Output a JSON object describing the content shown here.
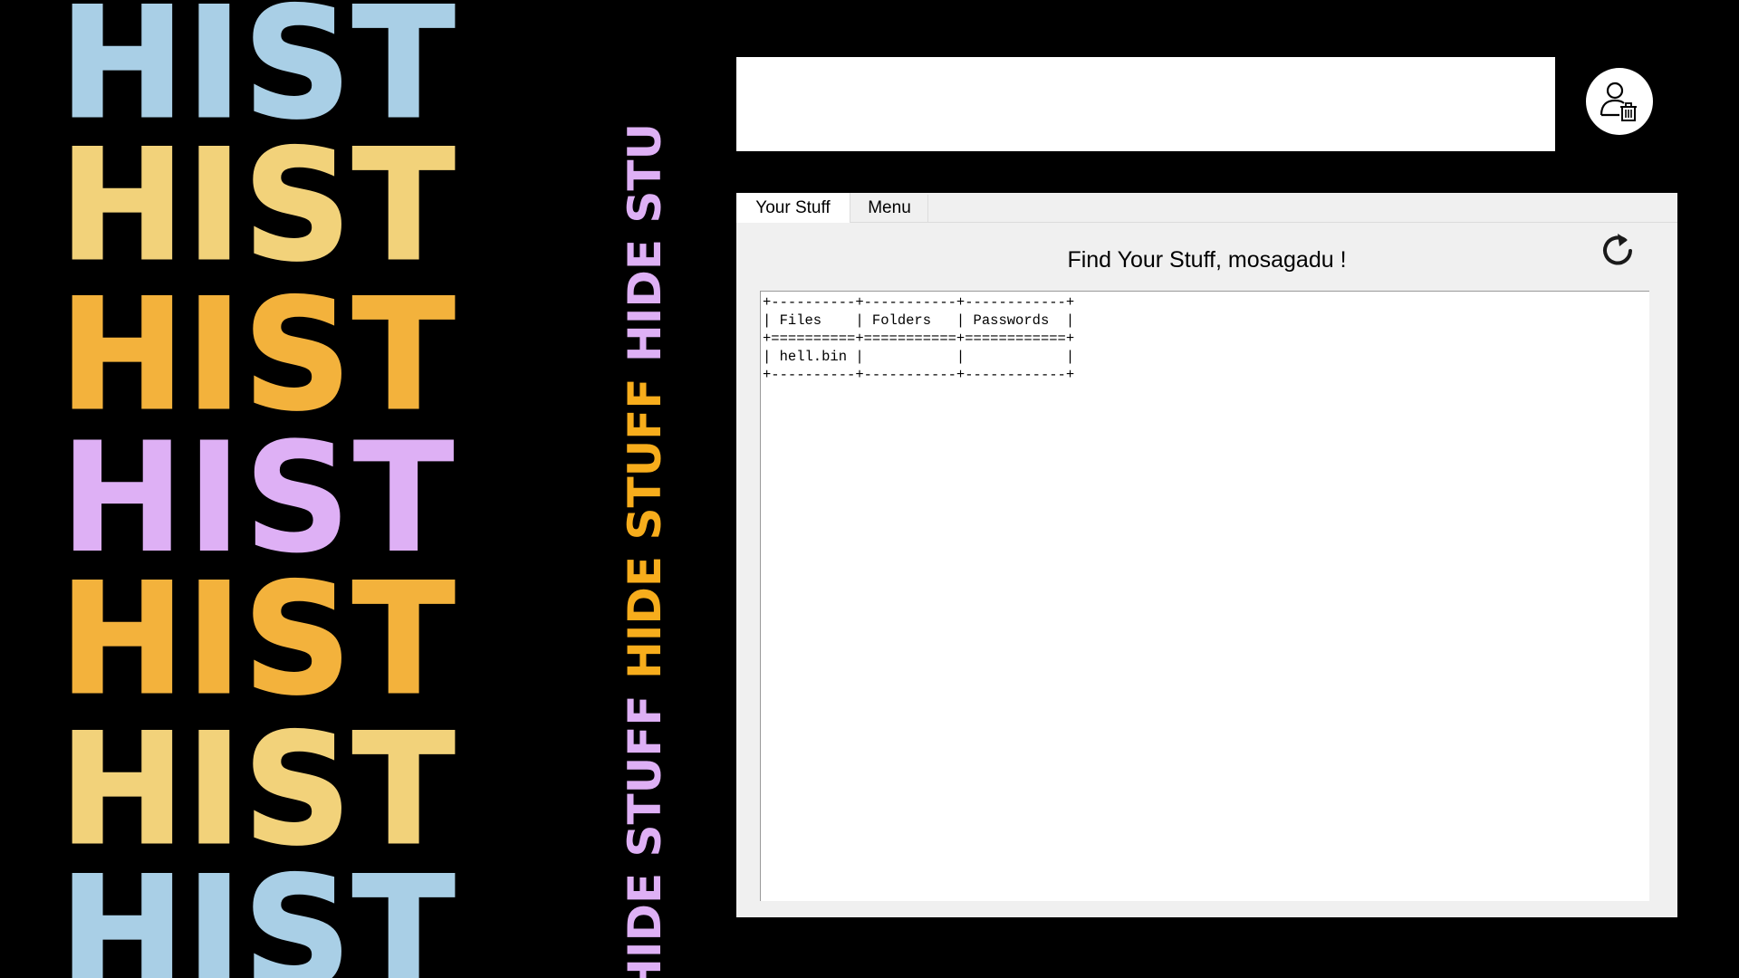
{
  "decor": {
    "hist_words": [
      {
        "text": "HIST",
        "color": "#a9cfe6",
        "style": "outline"
      },
      {
        "text": "HIST",
        "color": "#f2d27a",
        "style": "outline"
      },
      {
        "text": "HIST",
        "color": "#f3b23c",
        "style": "outline"
      },
      {
        "text": "HIST",
        "color": "#deb0f5",
        "style": "solid"
      },
      {
        "text": "HIST",
        "color": "#f3b23c",
        "style": "outline"
      },
      {
        "text": "HIST",
        "color": "#f2d27a",
        "style": "outline"
      },
      {
        "text": "HIST",
        "color": "#a9cfe6",
        "style": "outline"
      }
    ],
    "vertical_segments": [
      {
        "text": "HIDE ",
        "color": "#deb0f5"
      },
      {
        "text": "STUFF ",
        "color": "#deb0f5"
      },
      {
        "text": "HIDE ",
        "color": "#f7ad1c"
      },
      {
        "text": "STUFF ",
        "color": "#f7ad1c"
      },
      {
        "text": "HIDE ",
        "color": "#deb0f5"
      },
      {
        "text": "STU",
        "color": "#deb0f5"
      }
    ]
  },
  "header": {
    "avatar_icon": "user-trash-icon"
  },
  "tabs": [
    {
      "label": "Your Stuff",
      "active": true
    },
    {
      "label": "Menu",
      "active": false
    }
  ],
  "panel": {
    "title": "Find Your Stuff, mosagadu !",
    "refresh_icon": "refresh-icon",
    "table_text": "+----------+-----------+------------+\n| Files    | Folders   | Passwords  |\n+==========+===========+============+\n| hell.bin |           |            |\n+----------+-----------+------------+"
  }
}
